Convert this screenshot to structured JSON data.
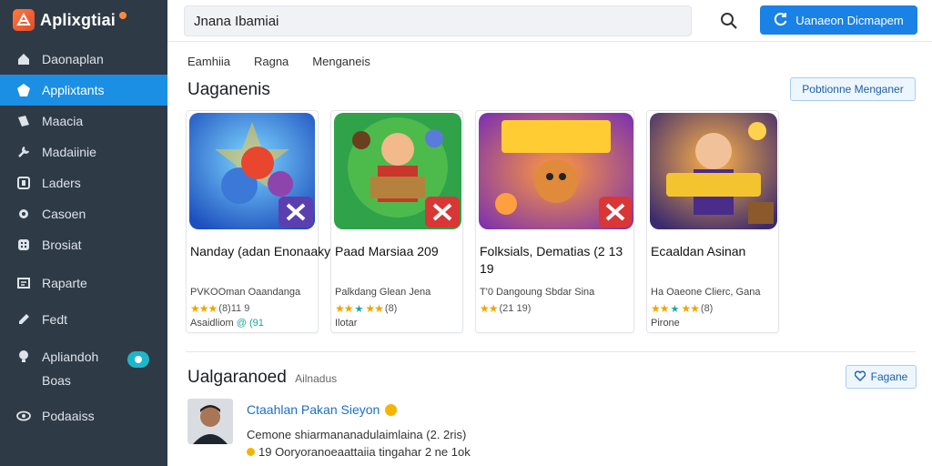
{
  "app": {
    "name": "Aplixgtiai",
    "accent": "#1a8fe3",
    "sidebar_bg": "#2f3a47"
  },
  "sidebar": {
    "items": [
      {
        "label": "Daonaplan",
        "icon": "dashboard-icon"
      },
      {
        "label": "Applixtants",
        "icon": "apps-icon",
        "active": true
      },
      {
        "label": "Maacia",
        "icon": "media-icon"
      },
      {
        "label": "Madaiinie",
        "icon": "tools-icon"
      },
      {
        "label": "Laders",
        "icon": "ledger-icon"
      },
      {
        "label": "Casoen",
        "icon": "settings-icon"
      },
      {
        "label": "Brosiat",
        "icon": "grid-icon"
      },
      {
        "label": "Raparte",
        "icon": "reports-icon"
      },
      {
        "label": "Fedt",
        "icon": "edit-icon"
      },
      {
        "label": "Apliandoh",
        "label2": "Boas",
        "icon": "bulb-icon",
        "toggle": true
      },
      {
        "label": "Podaaiss",
        "icon": "eye-icon"
      }
    ]
  },
  "header": {
    "search_value": "Jnana Ibamiai",
    "primary_button": "Uanaeon Dicmapem"
  },
  "main": {
    "tabs": [
      "Eamhiia",
      "Ragna",
      "Menganeis"
    ],
    "section1": {
      "title": "Uaganenis",
      "button": "Pobtionne Menganer"
    },
    "cards": [
      {
        "title": "Nanday (adan Enonaaky)",
        "meta": "PVKOOman Oaandanga",
        "rating_extra": "(8)11 9",
        "foot_prefix": "Asaidliom",
        "foot_accent": "@ (91"
      },
      {
        "title": "Paad Marsiaa 209",
        "meta": "Palkdang Glean Jena",
        "rating_extra": "(8)",
        "foot_prefix": "Ilotar",
        "foot_accent": ""
      },
      {
        "title": "Folksials, Dematias (2 13 19",
        "meta": "T'0 Dangoung Sbdar Sina",
        "rating_extra": "(21 19)",
        "foot_prefix": "",
        "foot_accent": ""
      },
      {
        "title": "Ecaaldan Asinan",
        "meta": "Ha Oaeone Clierc, Gana",
        "rating_extra": "(8)",
        "foot_prefix": "Pirone",
        "foot_accent": ""
      }
    ],
    "section2": {
      "title": "Ualgaranoed",
      "subtitle": "Ailnadus",
      "button": "Fagane"
    },
    "review": {
      "name": "Ctaahlan Pakan Sieyon",
      "line1": "Cemone shiarmananadulaimlaina (2. 2ris)",
      "line2": "19 Ooryoranoeaattaiia tingahar 2 ne 1ok"
    }
  }
}
